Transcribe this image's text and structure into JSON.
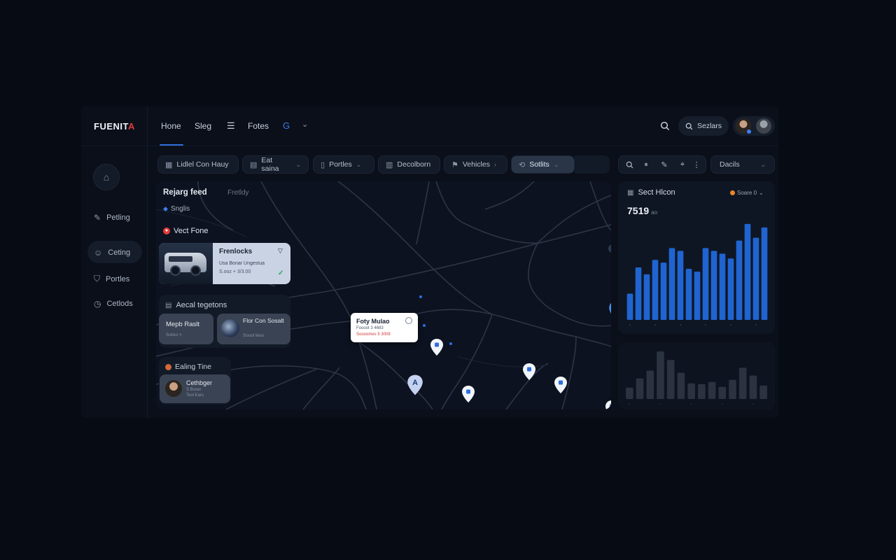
{
  "app": {
    "logo_main": "FUENIT",
    "logo_accent": "A"
  },
  "header": {
    "nav": [
      "Hone",
      "Sleg",
      "Fotes"
    ],
    "search_label": "Sezlars"
  },
  "sidebar": {
    "items": [
      {
        "label": "Petling",
        "icon": "pencil-icon"
      },
      {
        "label": "Ceting",
        "icon": "smile-icon"
      },
      {
        "label": "Portles",
        "icon": "shield-icon"
      },
      {
        "label": "Cetlods",
        "icon": "clock-icon"
      }
    ]
  },
  "filters": [
    {
      "label": "Lidlel Con Hauy",
      "icon": "grid-icon",
      "chevron": false,
      "active": false
    },
    {
      "label": "Eat saina",
      "icon": "list-icon",
      "chevron": true,
      "active": false
    },
    {
      "label": "Portles",
      "icon": "document-icon",
      "chevron": true,
      "active": false
    },
    {
      "label": "Decolborn",
      "icon": "building-icon",
      "chevron": false,
      "active": false
    },
    {
      "label": "Vehicles",
      "icon": "flag-icon",
      "chevron": true,
      "active": false
    },
    {
      "label": "Sotlits",
      "icon": "route-icon",
      "chevron": true,
      "active": true
    }
  ],
  "right_toolbar": {
    "dropdown_label": "Dacils"
  },
  "feed": {
    "tab_active": "Rejarg feed",
    "tab_inactive": "Fretldy",
    "singles": "Snglis",
    "vert_title": "Vect Fone",
    "vehicle": {
      "title": "Frenlocks",
      "line1": "Usa Bonar Ungestua",
      "line2": "S.ooz + 3/3.00"
    },
    "regions_title": "Aecal tegetons",
    "region_cards": [
      {
        "title": "Mepb Raslt",
        "sub": "Sotoo >"
      },
      {
        "title": "Flor Con Sosalt",
        "sub": "Sosol leso"
      }
    ],
    "billing_title": "Ealing Tine",
    "billing_card": {
      "title": "Cethbger",
      "sub1": "S Boser",
      "sub2": "Teol Ears"
    }
  },
  "map_tooltip": {
    "title": "Foty Mulao",
    "line1": "Foooot 3 4683",
    "line2": "Soooomes 5 3008"
  },
  "chart_panel": {
    "title": "Sect Hlcon",
    "badge": "Soare 0",
    "value": "7519",
    "value_suffix": "ao",
    "colors": {
      "bar": "#1f64d0",
      "bar_dim": "#2b3240",
      "badge_dot": "#e8872a"
    }
  },
  "chart_data": [
    {
      "type": "bar",
      "values": [
        38,
        76,
        66,
        87,
        83,
        104,
        100,
        74,
        70,
        104,
        100,
        96,
        89,
        115,
        139,
        119,
        134
      ],
      "ylim": [
        0,
        145
      ],
      "grid": false
    },
    {
      "type": "bar",
      "values": [
        16,
        29,
        40,
        67,
        55,
        37,
        22,
        21,
        24,
        17,
        27,
        44,
        33,
        19
      ],
      "ylim": [
        0,
        70
      ],
      "grid": false
    }
  ]
}
